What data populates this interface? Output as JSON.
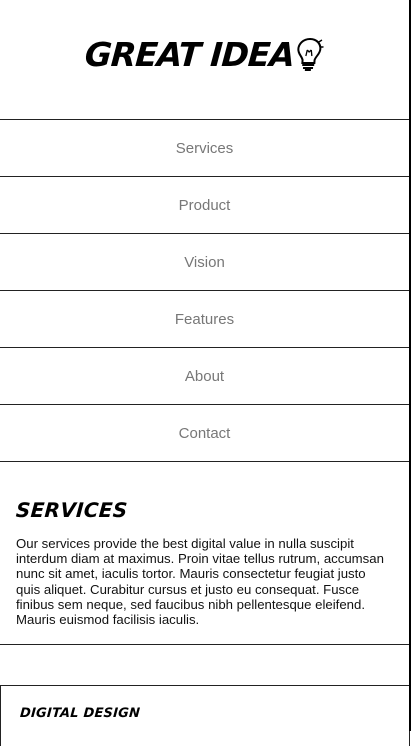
{
  "brand": {
    "logo_text": "GREAT IDEA",
    "logo_icon": "lightbulb-icon"
  },
  "nav": {
    "items": [
      {
        "label": "Services"
      },
      {
        "label": "Product"
      },
      {
        "label": "Vision"
      },
      {
        "label": "Features"
      },
      {
        "label": "About"
      },
      {
        "label": "Contact"
      }
    ]
  },
  "services": {
    "title": "SERVICES",
    "body": "Our services provide the best digital value in nulla suscipit interdum diam at maximus. Proin vitae tellus rutrum, accumsan nunc sit amet, iaculis tortor. Mauris consectetur feugiat justo quis aliquet. Curabitur cursus et justo eu consequat. Fusce finibus sem neque, sed faucibus nibh pellentesque eleifend. Mauris euismod facilisis iaculis."
  },
  "cards": [
    {
      "title": "DIGITAL DESIGN"
    }
  ],
  "colors": {
    "background": "#ffffff",
    "text": "#111111",
    "nav_text": "#777777",
    "border": "#222222"
  }
}
